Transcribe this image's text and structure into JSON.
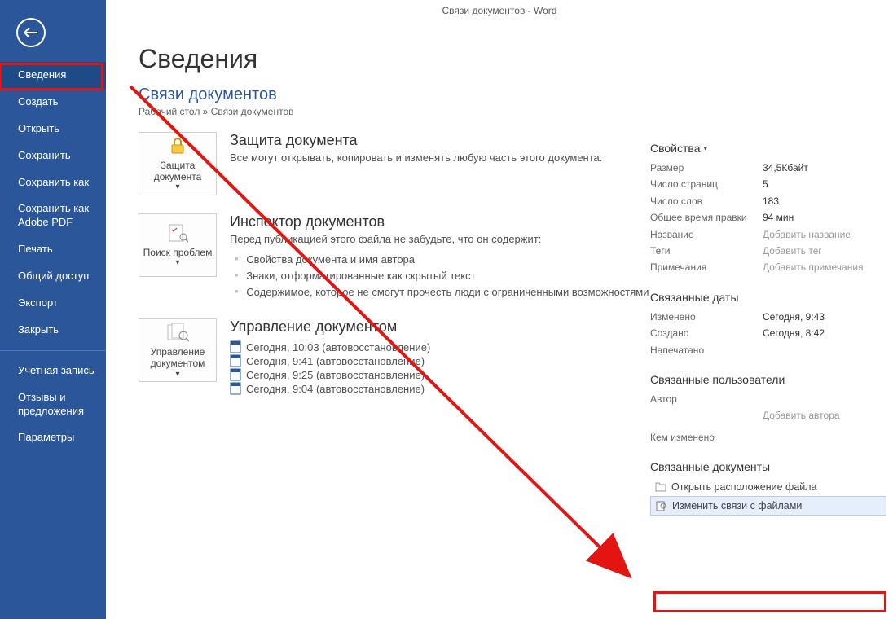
{
  "titlebar": "Связи документов  -  Word",
  "sidebar": {
    "items": [
      "Сведения",
      "Создать",
      "Открыть",
      "Сохранить",
      "Сохранить как",
      "Сохранить как Adobe PDF",
      "Печать",
      "Общий доступ",
      "Экспорт",
      "Закрыть"
    ],
    "lower": [
      "Учетная запись",
      "Отзывы и предложения",
      "Параметры"
    ]
  },
  "page": {
    "title": "Сведения",
    "docName": "Связи документов",
    "breadcrumb": "Рабочий стол » Связи документов"
  },
  "protect": {
    "btn": "Защита документа",
    "title": "Защита документа",
    "desc": "Все могут открывать, копировать и изменять любую часть этого документа."
  },
  "inspect": {
    "btn": "Поиск проблем",
    "title": "Инспектор документов",
    "lead": "Перед публикацией этого файла не забудьте, что он содержит:",
    "bullets": [
      "Свойства документа и имя автора",
      "Знаки, отформатированные как скрытый текст",
      "Содержимое, которое не смогут прочесть люди с ограниченными возможностями"
    ]
  },
  "manage": {
    "btn": "Управление документом",
    "title": "Управление документом",
    "items": [
      "Сегодня, 10:03 (автовосстановление)",
      "Сегодня, 9:41 (автовосстановление)",
      "Сегодня, 9:25 (автовосстановление)",
      "Сегодня, 9:04 (автовосстановление)"
    ]
  },
  "props": {
    "heading": "Свойства",
    "rows": [
      {
        "k": "Размер",
        "v": "34,5Кбайт"
      },
      {
        "k": "Число страниц",
        "v": "5"
      },
      {
        "k": "Число слов",
        "v": "183"
      },
      {
        "k": "Общее время правки",
        "v": "94 мин"
      },
      {
        "k": "Название",
        "ph": "Добавить название"
      },
      {
        "k": "Теги",
        "ph": "Добавить тег"
      },
      {
        "k": "Примечания",
        "ph": "Добавить примечания"
      }
    ]
  },
  "dates": {
    "heading": "Связанные даты",
    "rows": [
      {
        "k": "Изменено",
        "v": "Сегодня, 9:43"
      },
      {
        "k": "Создано",
        "v": "Сегодня, 8:42"
      },
      {
        "k": "Напечатано",
        "v": ""
      }
    ]
  },
  "users": {
    "heading": "Связанные пользователи",
    "author": "Автор",
    "addAuthor": "Добавить автора",
    "lastBy": "Кем изменено"
  },
  "related": {
    "heading": "Связанные документы",
    "openLoc": "Открыть расположение файла",
    "editLinks": "Изменить связи с файлами"
  }
}
